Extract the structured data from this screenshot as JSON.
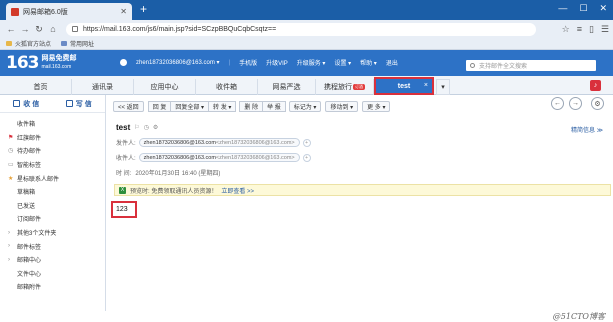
{
  "browser": {
    "tab_title": "网易邮箱6.0版",
    "new_tab": "+",
    "url": "https://mail.163.com/js6/main.jsp?sid=SCzpBBQuCqbCsqtz==",
    "bookmarks": [
      "火狐官方站点",
      "常用网址"
    ]
  },
  "mail_header": {
    "logo_number": "163",
    "logo_name": "网易免费邮",
    "logo_domain": "mail.163.com",
    "account": "zhen18732036806@163.com ▾",
    "links": [
      "手机版",
      "升级VIP",
      "升级服务 ▾",
      "设置 ▾",
      "帮助 ▾",
      "退出"
    ],
    "search_placeholder": "支持邮件全文搜索"
  },
  "tabs": {
    "items": [
      "首页",
      "通讯录",
      "应用中心",
      "收件箱",
      "网易严选",
      "携程旅行"
    ],
    "badge": "订酒",
    "active": "test",
    "close": "×"
  },
  "sidebar": {
    "receive": "收 信",
    "write": "写 信",
    "items": [
      {
        "label": "收件箱",
        "mark": ""
      },
      {
        "label": "红旗邮件",
        "mark": "flag"
      },
      {
        "label": "待办邮件",
        "mark": "clock"
      },
      {
        "label": "智能标签",
        "mark": "tag"
      },
      {
        "label": "星标联系人邮件",
        "mark": "star"
      },
      {
        "label": "草稿箱",
        "mark": ""
      },
      {
        "label": "已发送",
        "mark": ""
      },
      {
        "label": "订阅邮件",
        "mark": ""
      },
      {
        "label": "其他3个文件夹",
        "mark": "arrow"
      },
      {
        "label": "邮件标签",
        "mark": "arrow"
      },
      {
        "label": "邮箱中心",
        "mark": "arrow"
      },
      {
        "label": "文件中心",
        "mark": ""
      },
      {
        "label": "邮箱附件",
        "mark": ""
      }
    ]
  },
  "toolbar": {
    "back": "<< 返回",
    "reply": "回 复",
    "reply_all": "回复全部 ▾",
    "forward": "转 发 ▾",
    "delete": "删 除",
    "report": "举 报",
    "mark_as": "标记为 ▾",
    "move_to": "移动到 ▾",
    "more": "更 多 ▾"
  },
  "mail": {
    "subject": "test",
    "read_info": "精简信息 ≫",
    "from_label": "发件人:",
    "from_name": "zhen18732036806@163.com",
    "from_addr": "<zhen18732036806@163.com>",
    "to_label": "收件人:",
    "to_name": "zhen18732036806@163.com",
    "to_addr": "<zhen18732036806@163.com>",
    "time_label": "时  间:",
    "time_value": "2020年01月30日 16:40 (星期四)",
    "notice_text": "预览时: 免费领取通讯人员资源！",
    "notice_link": "立即查看 >>",
    "body": "123"
  },
  "watermark": "@51CTO博客"
}
